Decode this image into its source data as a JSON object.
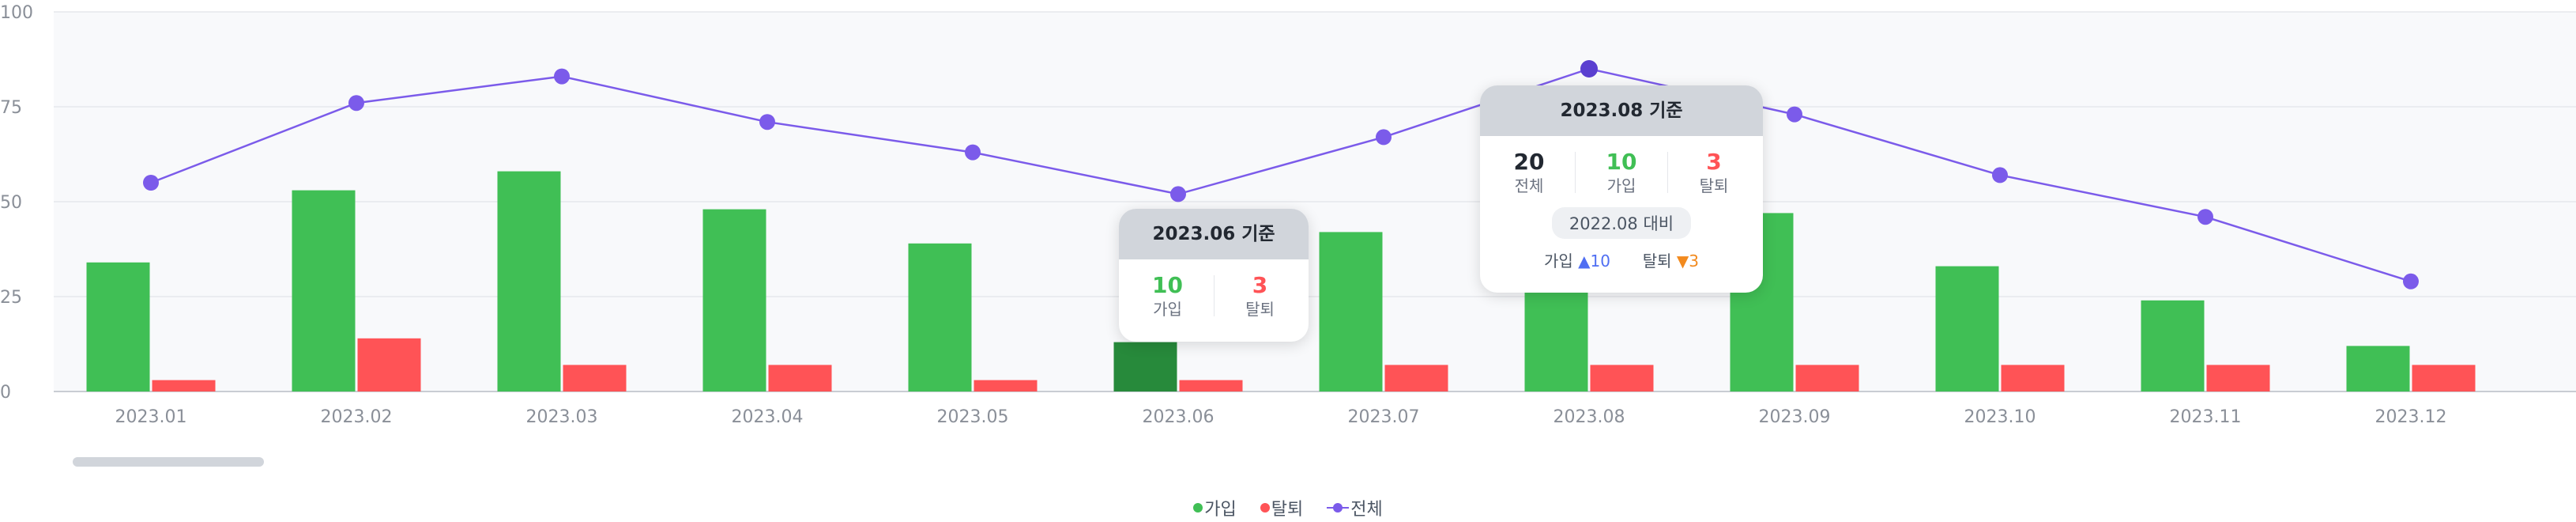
{
  "colors": {
    "join": "#40bf55",
    "join_active": "#278a3b",
    "leave": "#ff5356",
    "total": "#7b5bea",
    "total_active": "#5a3fd0",
    "neutral": "#222831"
  },
  "chart_data": {
    "type": "bar",
    "categories": [
      "2023.01",
      "2023.02",
      "2023.03",
      "2023.04",
      "2023.05",
      "2023.06",
      "2023.07",
      "2023.08",
      "2023.09",
      "2023.10",
      "2023.11",
      "2023.12"
    ],
    "ylim": [
      0,
      100
    ],
    "yticks": [
      0,
      25,
      50,
      75,
      100
    ],
    "grid": true,
    "legend_position": "bottom-center",
    "active_category": "2023.06",
    "series": [
      {
        "name": "가입",
        "type": "bar",
        "values": [
          34,
          53,
          58,
          48,
          39,
          13,
          42,
          27,
          47,
          33,
          24,
          12
        ]
      },
      {
        "name": "탈퇴",
        "type": "bar",
        "values": [
          3,
          14,
          7,
          7,
          3,
          3,
          7,
          7,
          7,
          7,
          7,
          7
        ]
      },
      {
        "name": "전체",
        "type": "line",
        "values": [
          55,
          76,
          83,
          71,
          63,
          52,
          67,
          85,
          73,
          57,
          46,
          29
        ]
      }
    ]
  },
  "tooltip_small": {
    "title": "2023.06 기준",
    "join_value": "10",
    "join_label": "가입",
    "leave_value": "3",
    "leave_label": "탈퇴"
  },
  "tooltip_large": {
    "title": "2023.08 기준",
    "total_value": "20",
    "total_label": "전체",
    "join_value": "10",
    "join_label": "가입",
    "leave_value": "3",
    "leave_label": "탈퇴",
    "compare_label": "2022.08 대비",
    "join_change_label": "가입",
    "join_change_value": "10",
    "join_change_arrow": "▲",
    "leave_change_label": "탈퇴",
    "leave_change_value": "3",
    "leave_change_arrow": "▼"
  },
  "legend": {
    "join_label": "가입",
    "leave_label": "탈퇴",
    "total_label": "전체"
  }
}
